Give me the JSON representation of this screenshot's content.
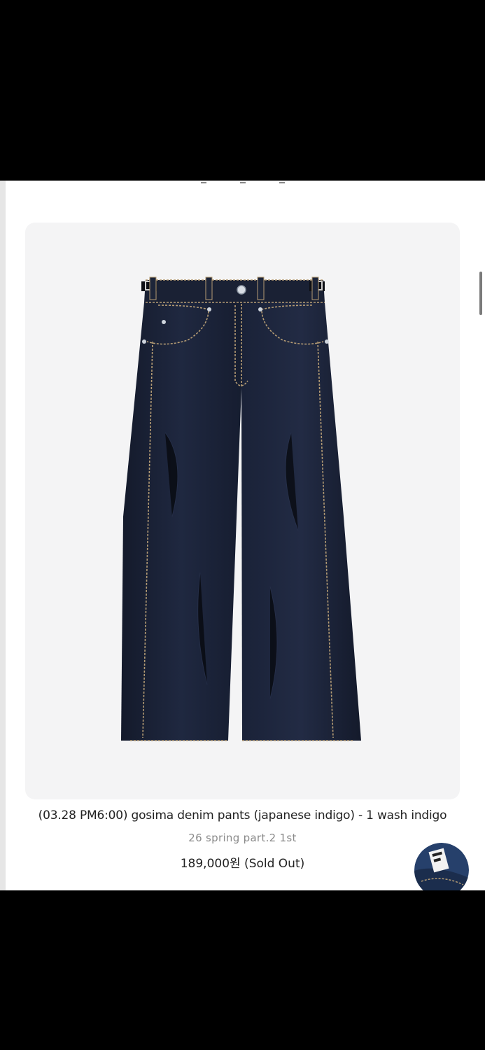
{
  "product": {
    "name": "(03.28 PM6:00) gosima denim pants (japanese indigo) - 1 wash indigo",
    "collection": "26 spring part.2 1st",
    "price": "189,000원 (Sold Out)",
    "image_icon": "denim-pants-photo"
  },
  "widget": {
    "icon": "chat-widget-icon"
  },
  "colors": {
    "card_background": "#f4f4f5",
    "denim": "#1a2236",
    "stitching": "#b59c74",
    "text_primary": "#222222",
    "text_secondary": "#8a8a8a"
  }
}
